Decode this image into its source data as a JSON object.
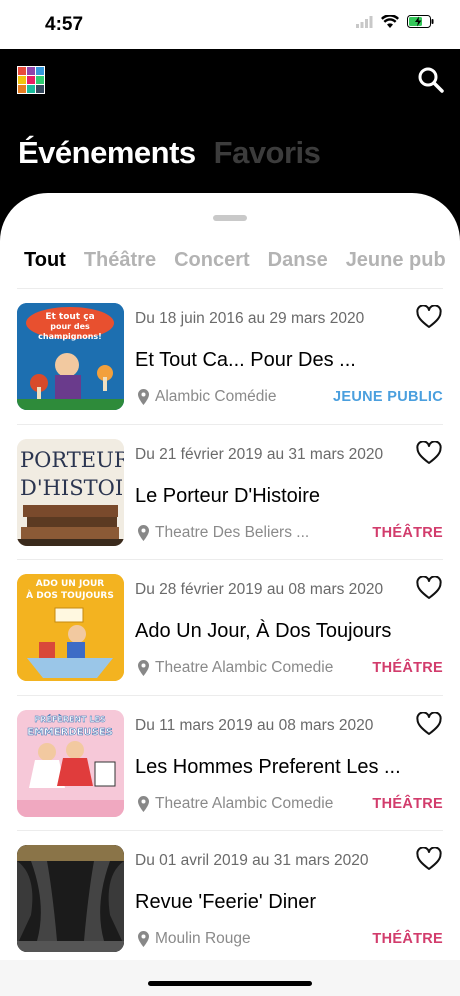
{
  "status": {
    "time": "4:57"
  },
  "header": {
    "tabs": [
      {
        "label": "Événements",
        "active": true
      },
      {
        "label": "Favoris",
        "active": false
      }
    ]
  },
  "categories": [
    {
      "label": "Tout",
      "active": true
    },
    {
      "label": "Théâtre",
      "active": false
    },
    {
      "label": "Concert",
      "active": false
    },
    {
      "label": "Danse",
      "active": false
    },
    {
      "label": "Jeune pub",
      "active": false
    }
  ],
  "events": [
    {
      "date": "Du 18 juin 2016 au 29 mars 2020",
      "title": "Et Tout Ca... Pour Des ...",
      "venue": "Alambic Comédie",
      "category": "JEUNE PUBLIC",
      "category_color": "#4a9fde",
      "favorite": false,
      "poster": {
        "bg": "#1d6fb0",
        "lines": [
          "Et tout ça",
          "pour des",
          "champignons!"
        ]
      }
    },
    {
      "date": "Du 21 février 2019 au 31 mars 2020",
      "title": "Le Porteur D'Histoire",
      "venue": "Theatre Des Beliers ...",
      "category": "THÉÂTRE",
      "category_color": "#d23c6c",
      "favorite": false,
      "poster": {
        "bg": "#f1ece2",
        "lines": [
          "PORTEUR",
          "D'HISTOIR"
        ]
      }
    },
    {
      "date": "Du 28 février 2019 au 08 mars 2020",
      "title": "Ado Un Jour, À Dos Toujours",
      "venue": "Theatre Alambic Comedie",
      "category": "THÉÂTRE",
      "category_color": "#d23c6c",
      "favorite": false,
      "poster": {
        "bg": "#f3b320",
        "lines": [
          "ADO UN JOUR",
          "À DOS TOUJOURS"
        ]
      }
    },
    {
      "date": "Du 11 mars 2019 au 08 mars 2020",
      "title": "Les Hommes Preferent Les ...",
      "venue": "Theatre Alambic Comedie",
      "category": "THÉÂTRE",
      "category_color": "#d23c6c",
      "favorite": false,
      "poster": {
        "bg": "#f6c8d8",
        "lines": [
          "PRÉFÈRENT LES",
          "EMMERDEUSES"
        ]
      }
    },
    {
      "date": "Du 01 avril 2019 au 31 mars 2020",
      "title": "Revue 'Feerie'   Diner",
      "venue": "Moulin Rouge",
      "category": "THÉÂTRE",
      "category_color": "#d23c6c",
      "favorite": false,
      "poster": {
        "bg": "#2a2a2a",
        "lines": []
      }
    }
  ],
  "colors": {
    "accent_theatre": "#d23c6c",
    "accent_jeune": "#4a9fde"
  },
  "icons": {
    "app_logo": "grid-logo-icon",
    "search": "search-icon",
    "heart": "heart-outline-icon",
    "pin": "location-pin-icon"
  }
}
